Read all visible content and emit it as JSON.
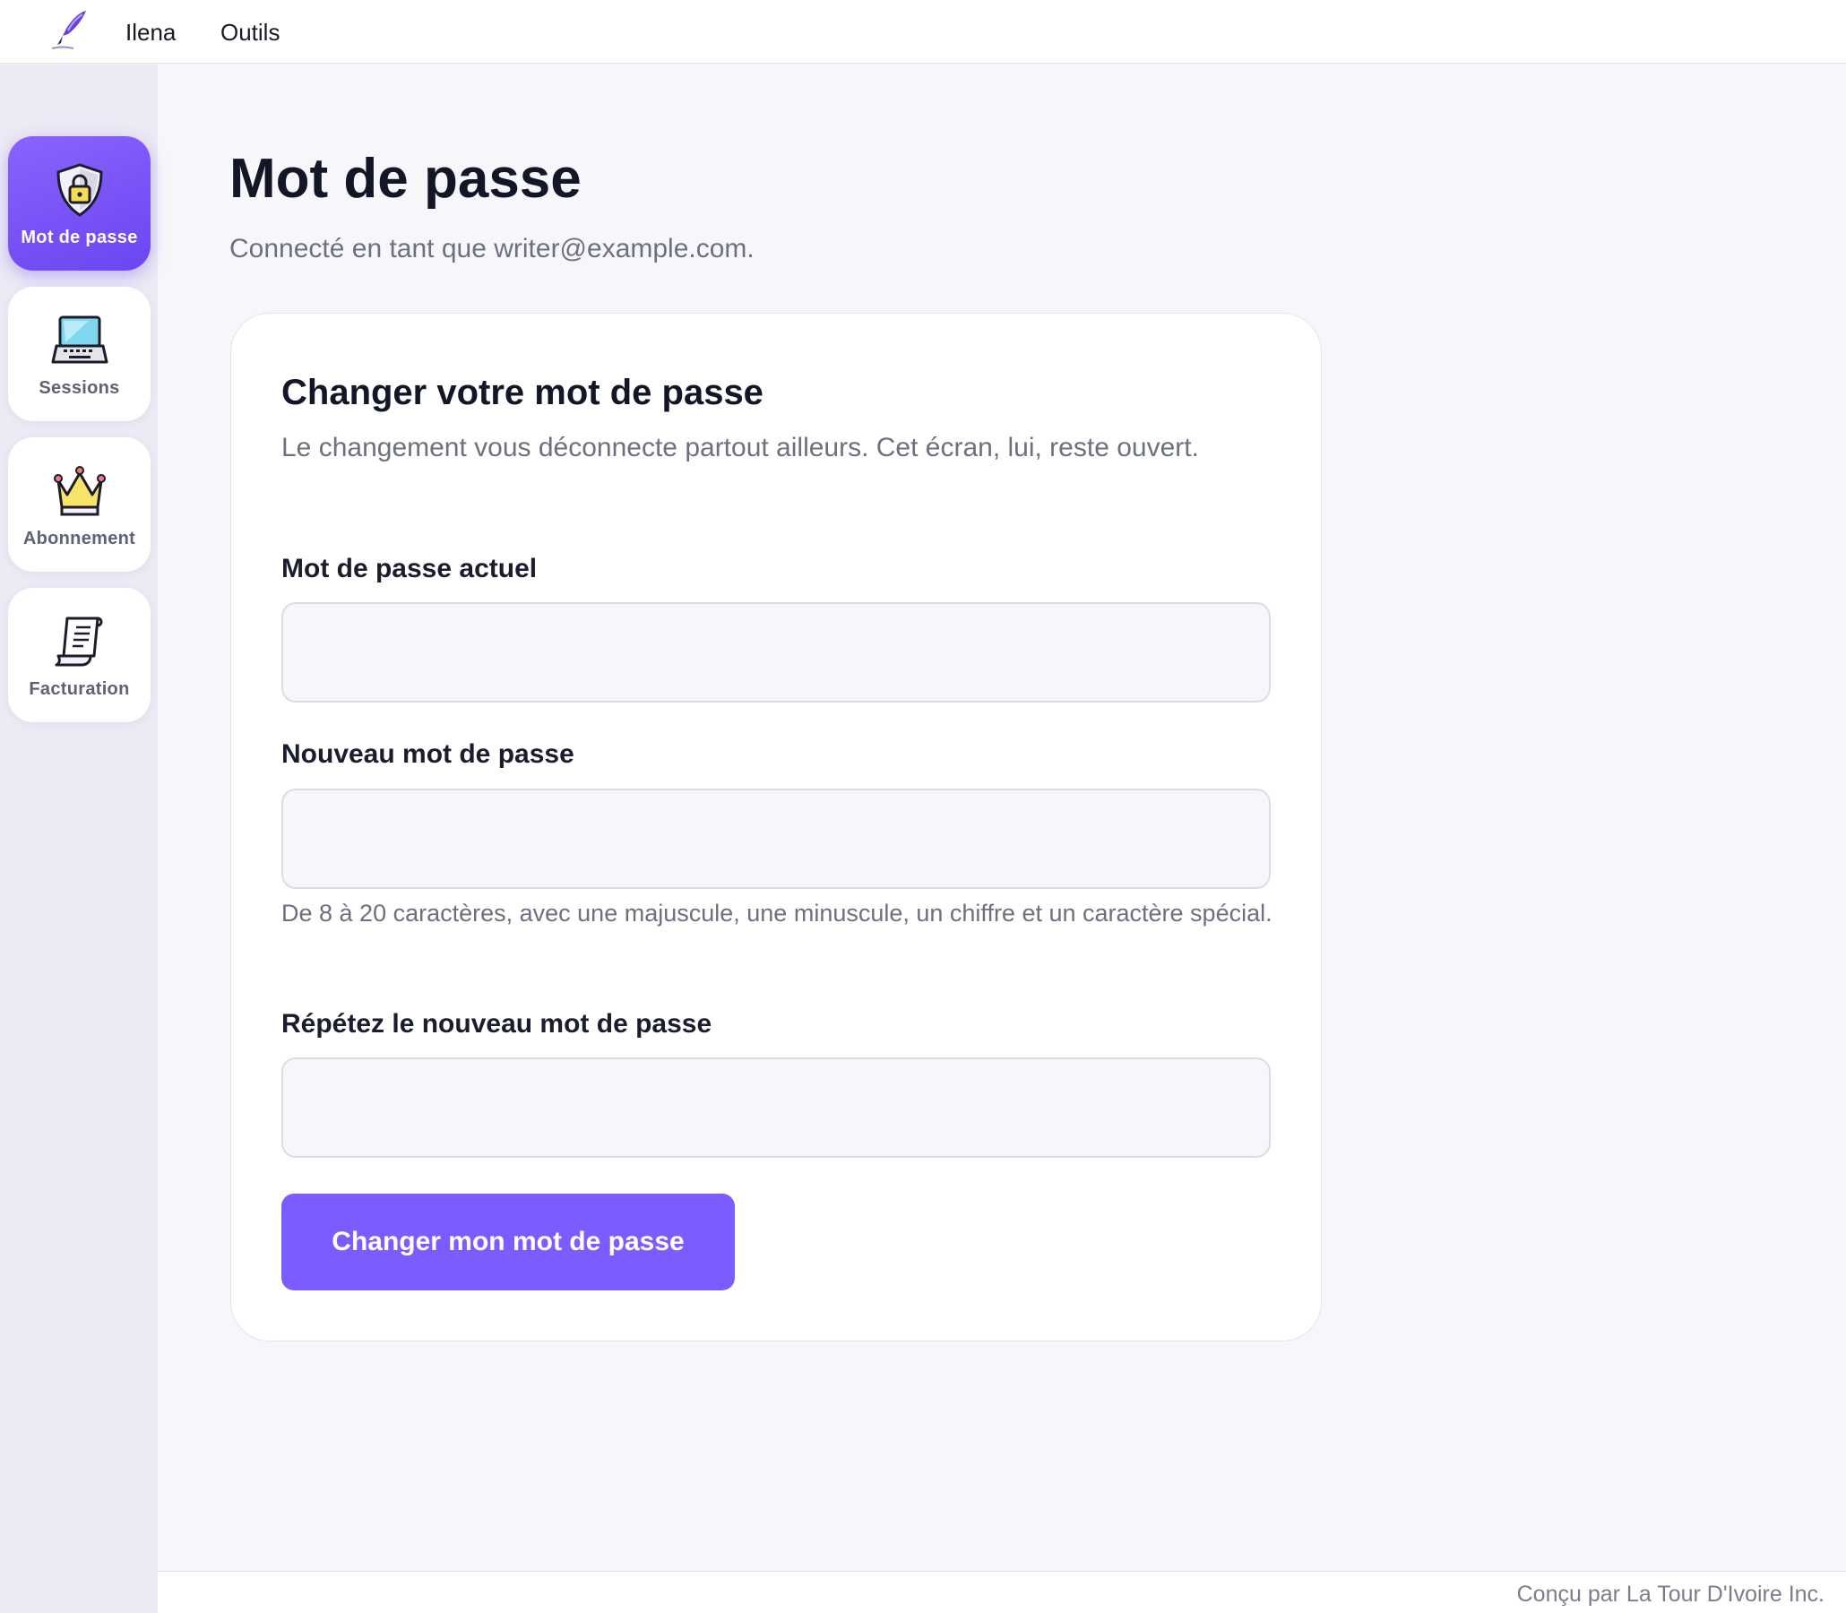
{
  "topbar": {
    "brand_link": "Ilena",
    "tools_link": "Outils"
  },
  "sidebar": {
    "items": [
      {
        "label": "Mot de passe",
        "icon": "shield-lock-icon",
        "active": true
      },
      {
        "label": "Sessions",
        "icon": "laptop-icon",
        "active": false
      },
      {
        "label": "Abonnement",
        "icon": "crown-icon",
        "active": false
      },
      {
        "label": "Facturation",
        "icon": "receipt-scroll-icon",
        "active": false
      }
    ]
  },
  "main": {
    "title": "Mot de passe",
    "subtitle": "Connecté en tant que writer@example.com."
  },
  "form": {
    "title": "Changer votre mot de passe",
    "description": "Le changement vous déconnecte partout ailleurs. Cet écran, lui, reste ouvert.",
    "current_label": "Mot de passe actuel",
    "current_value": "",
    "new_label": "Nouveau mot de passe",
    "new_value": "",
    "new_hint": "De 8 à 20 caractères, avec une majuscule, une minuscule, un chiffre et un caractère spécial.",
    "repeat_label": "Répétez le nouveau mot de passe",
    "repeat_value": "",
    "submit_label": "Changer mon mot de passe"
  },
  "footer": {
    "credit": "Conçu par La Tour D'Ivoire Inc."
  },
  "colors": {
    "accent": "#7b5cff",
    "accent_gradient_start": "#8a63ff",
    "accent_gradient_end": "#6b45f0",
    "background": "#f7f7fb",
    "sidebar_bg": "#ebeaf5",
    "text_primary": "#131627",
    "text_muted": "#6d7080"
  }
}
